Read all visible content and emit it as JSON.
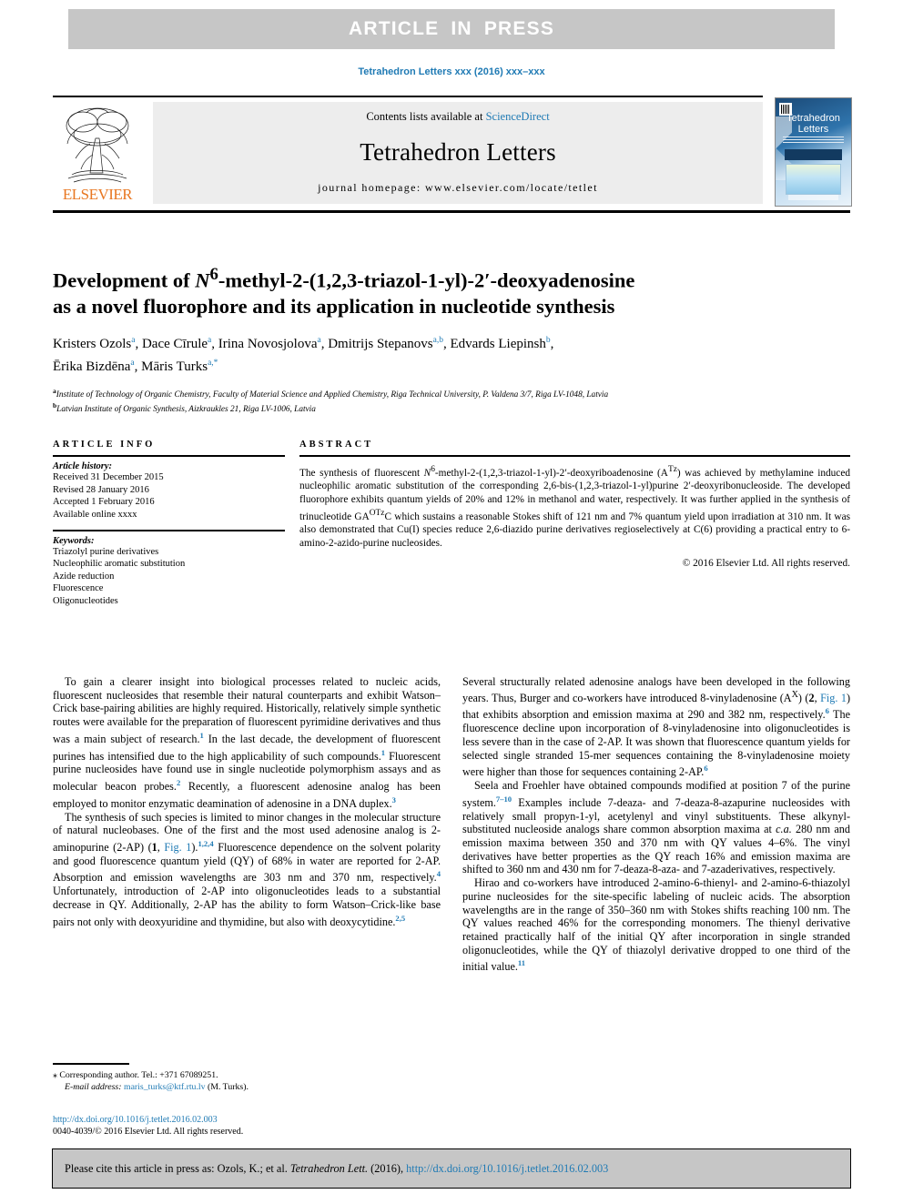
{
  "banner": {
    "article_in_press": "ARTICLE IN PRESS"
  },
  "running_head": "Tetrahedron Letters xxx (2016) xxx–xxx",
  "masthead": {
    "contents_prefix": "Contents lists available at ",
    "sciencedirect": "ScienceDirect",
    "journal_title": "Tetrahedron Letters",
    "homepage": "journal homepage: www.elsevier.com/locate/tetlet",
    "publisher_wordmark": "ELSEVIER",
    "cover_title": "Tetrahedron Letters"
  },
  "article": {
    "title_line1_pre": "Development of ",
    "title_n6": "N",
    "title_n6_sup": "6",
    "title_line1_post": "-methyl-2-(1,2,3-triazol-1-yl)-2′-deoxyadenosine",
    "title_line2": "as a novel fluorophore and its application in nucleotide synthesis",
    "authors": [
      {
        "name": "Kristers Ozols",
        "aff": "a",
        "sep": ", "
      },
      {
        "name": "Dace Cīrule",
        "aff": "a",
        "sep": ", "
      },
      {
        "name": "Irina Novosjolova",
        "aff": "a",
        "sep": ", "
      },
      {
        "name": "Dmitrijs Stepanovs",
        "aff": "a,b",
        "sep": ", "
      },
      {
        "name": "Edvards Liepinsh",
        "aff": "b",
        "sep": ", "
      },
      {
        "name": "Ērika Bizdēna",
        "aff": "a",
        "sep": ", "
      },
      {
        "name": "Māris Turks",
        "aff": "a,*",
        "sep": ""
      }
    ],
    "affiliations": [
      {
        "mark": "a",
        "text": "Institute of Technology of Organic Chemistry, Faculty of Material Science and Applied Chemistry, Riga Technical University, P. Valdena 3/7, Riga LV-1048, Latvia"
      },
      {
        "mark": "b",
        "text": "Latvian Institute of Organic Synthesis, Aizkraukles 21, Riga LV-1006, Latvia"
      }
    ]
  },
  "article_info": {
    "heading": "ARTICLE INFO",
    "history_label": "Article history:",
    "history": [
      "Received 31 December 2015",
      "Revised 28 January 2016",
      "Accepted 1 February 2016",
      "Available online xxxx"
    ],
    "keywords_label": "Keywords:",
    "keywords": [
      "Triazolyl purine derivatives",
      "Nucleophilic aromatic substitution",
      "Azide reduction",
      "Fluorescence",
      "Oligonucleotides"
    ]
  },
  "abstract": {
    "heading": "ABSTRACT",
    "text": "The synthesis of fluorescent N6-methyl-2-(1,2,3-triazol-1-yl)-2′-deoxyriboadenosine (ATz) was achieved by methylamine induced nucleophilic aromatic substitution of the corresponding 2,6-bis-(1,2,3-triazol-1-yl)purine 2′-deoxyribonucleoside. The developed fluorophore exhibits quantum yields of 20% and 12% in methanol and water, respectively. It was further applied in the synthesis of trinucleotide GAOTzC which sustains a reasonable Stokes shift of 121 nm and 7% quantum yield upon irradiation at 310 nm. It was also demonstrated that Cu(I) species reduce 2,6-diazido purine derivatives regioselectively at C(6) providing a practical entry to 6-amino-2-azido-purine nucleosides.",
    "copyright": "© 2016 Elsevier Ltd. All rights reserved."
  },
  "body": {
    "left_paragraphs": [
      "To gain a clearer insight into biological processes related to nucleic acids, fluorescent nucleosides that resemble their natural counterparts and exhibit Watson–Crick base-pairing abilities are highly required. Historically, relatively simple synthetic routes were available for the preparation of fluorescent pyrimidine derivatives and thus was a main subject of research.1 In the last decade, the development of fluorescent purines has intensified due to the high applicability of such compounds.1 Fluorescent purine nucleosides have found use in single nucleotide polymorphism assays and as molecular beacon probes.2 Recently, a fluorescent adenosine analog has been employed to monitor enzymatic deamination of adenosine in a DNA duplex.3",
      "The synthesis of such species is limited to minor changes in the molecular structure of natural nucleobases. One of the first and the most used adenosine analog is 2-aminopurine (2-AP) (1, Fig. 1).1,2,4 Fluorescence dependence on the solvent polarity and good fluorescence quantum yield (QY) of 68% in water are reported for 2-AP. Absorption and emission wavelengths are 303 nm and 370 nm, respectively.4 Unfortunately, introduction of 2-AP into oligonucleotides leads to a substantial decrease in QY. Additionally, 2-AP has the ability to form Watson–Crick-like base pairs not only with deoxyuridine and thymidine, but also with deoxycytidine.2,5"
    ],
    "right_paragraphs": [
      "Several structurally related adenosine analogs have been developed in the following years. Thus, Burger and co-workers have introduced 8-vinyladenosine (AX) (2, Fig. 1) that exhibits absorption and emission maxima at 290 and 382 nm, respectively.6 The fluorescence decline upon incorporation of 8-vinyladenosine into oligonucleotides is less severe than in the case of 2-AP. It was shown that fluorescence quantum yields for selected single stranded 15-mer sequences containing the 8-vinyladenosine moiety were higher than those for sequences containing 2-AP.6",
      "Seela and Froehler have obtained compounds modified at position 7 of the purine system.7–10 Examples include 7-deaza- and 7-deaza-8-azapurine nucleosides with relatively small propyn-1-yl, acetylenyl and vinyl substituents. These alkynyl-substituted nucleoside analogs share common absorption maxima at c.a. 280 nm and emission maxima between 350 and 370 nm with QY values 4–6%. The vinyl derivatives have better properties as the QY reach 16% and emission maxima are shifted to 360 nm and 430 nm for 7-deaza-8-aza- and 7-azaderivatives, respectively.",
      "Hirao and co-workers have introduced 2-amino-6-thienyl- and 2-amino-6-thiazolyl purine nucleosides for the site-specific labeling of nucleic acids. The absorption wavelengths are in the range of 350–360 nm with Stokes shifts reaching 100 nm. The QY values reached 46% for the corresponding monomers. The thienyl derivative retained practically half of the initial QY after incorporation in single stranded oligonucleotides, while the QY of thiazolyl derivative dropped to one third of the initial value.11"
    ]
  },
  "footnote": {
    "corresponding_mark": "⁎",
    "corresponding": "Corresponding author. Tel.: +371 67089251.",
    "email_label": "E-mail address:",
    "email": "maris_turks@ktf.rtu.lv",
    "email_owner": "(M. Turks).",
    "doi": "http://dx.doi.org/10.1016/j.tetlet.2016.02.003",
    "issn_line": "0040-4039/© 2016 Elsevier Ltd. All rights reserved."
  },
  "cite_box": {
    "prefix": "Please cite this article in press as: Ozols, K.; et al. ",
    "journal": "Tetrahedron Lett.",
    "middle": " (2016), ",
    "link": "http://dx.doi.org/10.1016/j.tetlet.2016.02.003"
  },
  "colors": {
    "accent_blue": "#1f7ab4",
    "elsevier_orange": "#e87722",
    "banner_gray": "#c6c6c6",
    "masthead_gray": "#ededed"
  }
}
